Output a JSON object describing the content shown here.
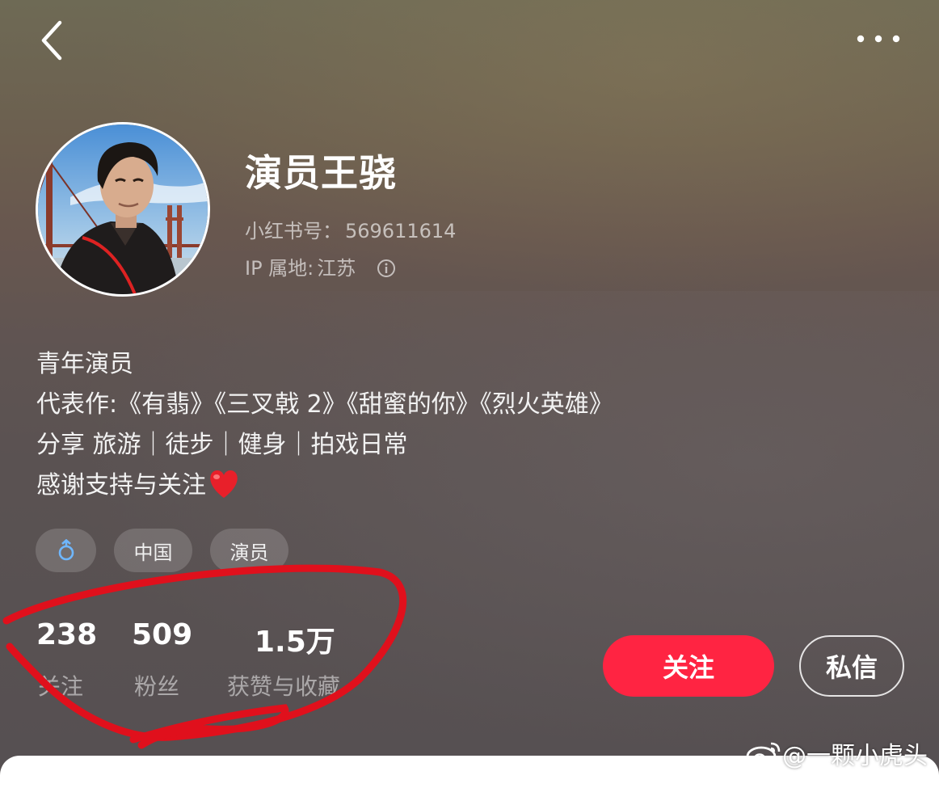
{
  "profile": {
    "name": "演员王骁",
    "id_label": "小红书号：",
    "id_value": "569611614",
    "ip_label": "IP 属地:",
    "ip_value": "江苏"
  },
  "bio": {
    "line1": "青年演员",
    "line2": "代表作:《有翡》《三叉戟 2》《甜蜜的你》《烈火英雄》",
    "line3": "分享 旅游｜徒步｜健身｜拍戏日常",
    "line4": "感谢支持与关注"
  },
  "tags": {
    "gender_icon": "male-icon",
    "country": "中国",
    "profession": "演员"
  },
  "stats": {
    "following_count": "238",
    "following_label": "关注",
    "followers_count": "509",
    "followers_label": "粉丝",
    "likes_count": "1.5万",
    "likes_label": "获赞与收藏"
  },
  "actions": {
    "follow_label": "关注",
    "message_label": "私信"
  },
  "colors": {
    "accent": "#ff2442",
    "annotation": "#e0101c"
  },
  "watermark": "@一颗小虎头"
}
